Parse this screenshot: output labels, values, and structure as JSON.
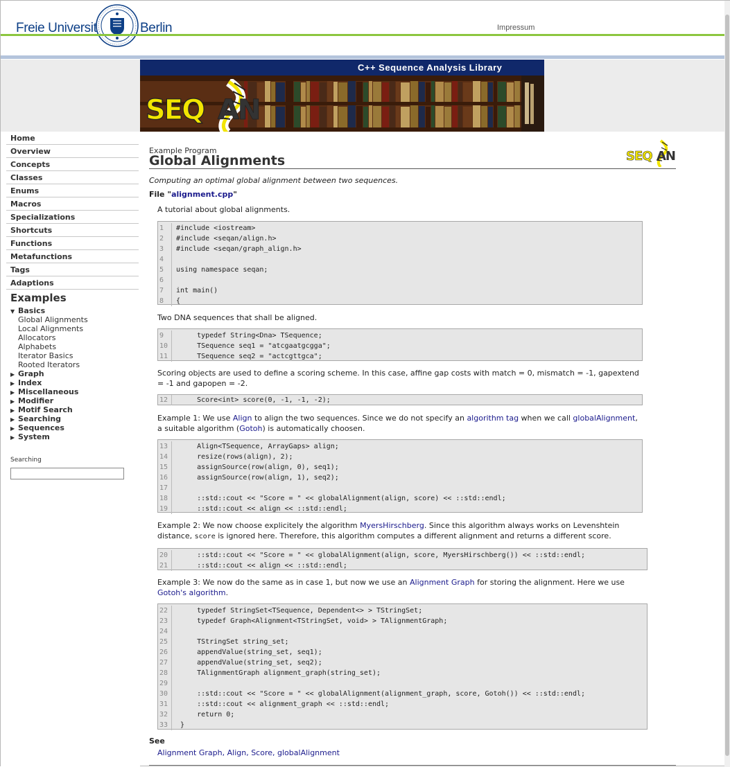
{
  "header": {
    "brand_left": "Freie Universität",
    "brand_right": "Berlin",
    "impressum": "Impressum"
  },
  "banner": {
    "title": "C++ Sequence Analysis Library",
    "logo_text": "SEQAN"
  },
  "nav": [
    "Home",
    "Overview",
    "Concepts",
    "Classes",
    "Enums",
    "Macros",
    "Specializations",
    "Shortcuts",
    "Functions",
    "Metafunctions",
    "Tags",
    "Adaptions"
  ],
  "examples": {
    "heading": "Examples",
    "groups": [
      {
        "label": "Basics",
        "expanded": true,
        "items": [
          "Global Alignments",
          "Local Alignments",
          "Allocators",
          "Alphabets",
          "Iterator Basics",
          "Rooted Iterators"
        ]
      },
      {
        "label": "Graph",
        "expanded": false,
        "items": []
      },
      {
        "label": "Index",
        "expanded": false,
        "items": []
      },
      {
        "label": "Miscellaneous",
        "expanded": false,
        "items": []
      },
      {
        "label": "Modifier",
        "expanded": false,
        "items": []
      },
      {
        "label": "Motif Search",
        "expanded": false,
        "items": []
      },
      {
        "label": "Searching",
        "expanded": false,
        "items": []
      },
      {
        "label": "Sequences",
        "expanded": false,
        "items": []
      },
      {
        "label": "System",
        "expanded": false,
        "items": []
      }
    ]
  },
  "search": {
    "label": "Searching",
    "value": ""
  },
  "content": {
    "subtitle": "Example Program",
    "title": "Global Alignments",
    "logo_text": "SEQAN",
    "intro": "Computing an optimal global alignment between two sequences.",
    "file_prefix": "File \"",
    "file_name": "alignment.cpp",
    "file_suffix": "\"",
    "p1": "A tutorial about global alignments.",
    "p2": "Two DNA sequences that shall be aligned.",
    "p3": "Scoring objects are used to define a scoring scheme. In this case, affine gap costs with match = 0, mismatch = -1, gapextend = -1 and gapopen = -2.",
    "p4": {
      "a": "Example 1: We use ",
      "link1": "Align",
      "b": " to align the two sequences. Since we do not specify an ",
      "link2": "algorithm tag",
      "c": " when we call ",
      "link3": "globalAlignment",
      "d": ", a suitable algorithm (",
      "link4": "Gotoh",
      "e": ") is automatically choosen."
    },
    "p5": {
      "a": "Example 2: We now choose explicitely the algorithm ",
      "link1": "MyersHirschberg",
      "b": ". Since this algorithm always works on Levenshtein distance, ",
      "code": "score",
      "c": " is ignored here. Therefore, this algorithm computes a different alignment and returns a different score."
    },
    "p6": {
      "a": "Example 3: We now do the same as in case 1, but now we use an ",
      "link1": "Alignment Graph",
      "b": " for storing the alignment. Here we use ",
      "link2": "Gotoh's algorithm",
      "c": "."
    },
    "code_blocks": [
      [
        [
          "1",
          "#include <iostream>"
        ],
        [
          "2",
          "#include <seqan/align.h>"
        ],
        [
          "3",
          "#include <seqan/graph_align.h>"
        ],
        [
          "4",
          ""
        ],
        [
          "5",
          "using namespace seqan;"
        ],
        [
          "6",
          ""
        ],
        [
          "7",
          "int main()"
        ],
        [
          "8",
          "{"
        ]
      ],
      [
        [
          "9",
          "     typedef String<Dna> TSequence;"
        ],
        [
          "10",
          "     TSequence seq1 = \"atcgaatgcgga\";"
        ],
        [
          "11",
          "     TSequence seq2 = \"actcgttgca\";"
        ]
      ],
      [
        [
          "12",
          "     Score<int> score(0, -1, -1, -2);"
        ]
      ],
      [
        [
          "13",
          "     Align<TSequence, ArrayGaps> align;"
        ],
        [
          "14",
          "     resize(rows(align), 2);"
        ],
        [
          "15",
          "     assignSource(row(align, 0), seq1);"
        ],
        [
          "16",
          "     assignSource(row(align, 1), seq2);"
        ],
        [
          "17",
          ""
        ],
        [
          "18",
          "     ::std::cout << \"Score = \" << globalAlignment(align, score) << ::std::endl;"
        ],
        [
          "19",
          "     ::std::cout << align << ::std::endl;"
        ]
      ],
      [
        [
          "20",
          "     ::std::cout << \"Score = \" << globalAlignment(align, score, MyersHirschberg()) << ::std::endl;"
        ],
        [
          "21",
          "     ::std::cout << align << ::std::endl;"
        ]
      ],
      [
        [
          "22",
          "     typedef StringSet<TSequence, Dependent<> > TStringSet;"
        ],
        [
          "23",
          "     typedef Graph<Alignment<TStringSet, void> > TAlignmentGraph;"
        ],
        [
          "24",
          ""
        ],
        [
          "25",
          "     TStringSet string_set;"
        ],
        [
          "26",
          "     appendValue(string_set, seq1);"
        ],
        [
          "27",
          "     appendValue(string_set, seq2);"
        ],
        [
          "28",
          "     TAlignmentGraph alignment_graph(string_set);"
        ],
        [
          "29",
          ""
        ],
        [
          "30",
          "     ::std::cout << \"Score = \" << globalAlignment(alignment_graph, score, Gotoh()) << ::std::endl;"
        ],
        [
          "31",
          "     ::std::cout << alignment_graph << ::std::endl;"
        ],
        [
          "32",
          "     return 0;"
        ],
        [
          "33",
          " }"
        ]
      ]
    ],
    "see_heading": "See",
    "see_links": [
      "Alignment Graph",
      "Align",
      "Score",
      "globalAlignment"
    ]
  },
  "colors": {
    "fu_blue": "#0d3f86",
    "fu_green": "#8cc63f",
    "banner_navy": "#10286a",
    "link": "#1a1a8c",
    "code_bg": "#e6e6e6",
    "seqan_yellow": "#f2e500"
  }
}
